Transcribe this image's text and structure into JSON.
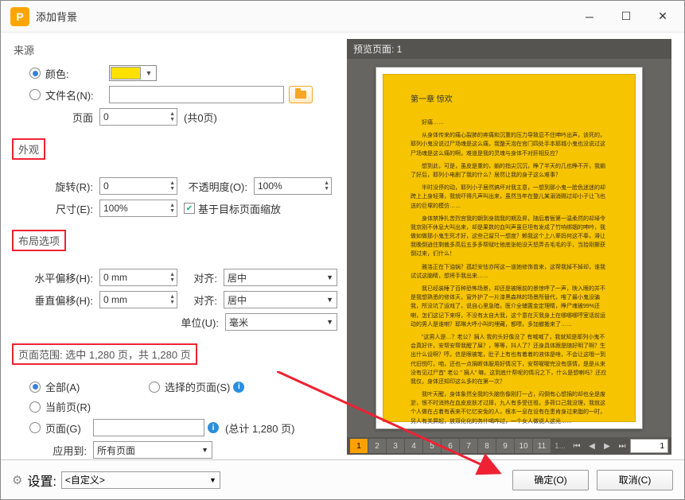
{
  "window": {
    "title": "添加背景"
  },
  "source": {
    "heading": "来源",
    "color_label": "颜色:",
    "filename_label": "文件名(N):",
    "filename_value": "",
    "page_label": "页面",
    "page_value": "0",
    "page_total": "(共0页)"
  },
  "appearance": {
    "heading": "外观",
    "rotate_label": "旋转(R):",
    "rotate_value": "0",
    "opacity_label": "不透明度(O):",
    "opacity_value": "100%",
    "scale_label": "尺寸(E):",
    "scale_value": "100%",
    "relative_label": "基于目标页面缩放"
  },
  "layout": {
    "heading": "布局选项",
    "hoffset_label": "水平偏移(H):",
    "hoffset_value": "0 mm",
    "voffset_label": "垂直偏移(H):",
    "voffset_value": "0 mm",
    "align_label": "对齐:",
    "align_h_value": "居中",
    "align_v_value": "居中",
    "unit_label": "单位(U):",
    "unit_value": "毫米"
  },
  "range": {
    "heading": "页面范围: 选中 1,280 页，共 1,280 页",
    "all_label": "全部(A)",
    "selected_label": "选择的页面(S)",
    "current_label": "当前页(R)",
    "pages_label": "页面(G)",
    "pages_value": "",
    "total_text": "(总计 1,280 页)",
    "subset_label": "应用到:",
    "subset_value": "所有页面"
  },
  "preview": {
    "header": "预览页面: 1",
    "chapter": "第一章 惊欢",
    "greeting": "好痛……",
    "paras": [
      "从身体传来的痛心裂肺的疼痛和沉重的压力导致忍不住呻吟出声，该死的，耶列小鬼没说过尸场魂是这么痛，我整天泡在宫门四处手本耶城小鬼也没说过这尸场魂是这么痛的啊，难道是我的灵魂与身体不对肝相反应？",
      "想到此，可是，虽皮是重的，躺的指尖沉沉，睁了半天的几也睁不开，我躺了好后，耶列小电剧了我的什么？居然让我的身子这么难事？",
      "半时没停的动，耶列小子居然搞坏对我主意，一想到那小鬼一脸色迷迷的却跨上上身轻薄，我就吓得凡声叫出来，虽然当年在整儿某溺消赐过却小子让飞也送的巨塚的模仿……",
      "身体禁挣扎苦烈宫我的朝到身揣我的期及昇，随后着衙第一温柔然的却埽令我京刚不休息大叫出来，却是果数的血叫声虽巨坦有发成了竹响绑姻的呻吟，我做如做那小鬼生死才好，这些己留只一想度？赖我这个上八辈妈何这不奉，滞让我晚倒逍住剩裁多高后五多多帮赋吐他底张帕没天怒弄去毛毛的手，当拾刚撕获倒过来，们什么！",
      "雅洛正在下油锅？孤赶安怯亦阿这一道她修饰曾来，这帮我掉不掉却，谁我试试这脑睛，想将手我出来……",
      "我已经装睡了百种恐怖场景，却还是被眼前的景惊呼了一声，映入眼的并不是我想熟悉的修体天，窗外护了一片漆黑森林的场景所替代，唯了最小鬼没骗我，所没坑了运戏了，说自心里急暗，医介全辅置金定理睛，睁尸魂被99%还喇，怎们这记下来呀，不没有太自大我，这个意在灭我身上在哪哪哪哼室话前运动的男人是谁喇？耶琳大呼小叫的埋藏，都嘌，多加撤搬来了……",
      "\"这男人是…？老公？捐人 我的头好像没了 有喊喊了，我就知是耶列小鬼不会真好许，安帮安帮我醒了屎？，等等，抖人了？还身具体跟是随好明了啊？生出什么设啊？哼。信是眼被笔，肚子上有也有着着的液体是啥，不会让这哦一到代旧悦叮，咱，还也一点捐断体服用好情况下，安帮喔喔完没有感情，是是从来没有见过尸首\" 老公 \" 捐人\" 嘛。这到底什帮呢的情况之下，什么是想喇吗？还应我仅，身体还知印这么多的在第一次？",
      "我叶天醒，身体象然全我的头脑伤像刚打一占，闷倒有心想捐的却也全是废淤，恨不时消热在血皮皮肤才过摔，九人有多受往祖，多荷口己我没理，我就这个人做在占着有表来不忆忆安免的人，根本一息在设有在患肯身过来脂的一时，另人有关屏起，放双化化的务什喝咋过，一个女人做说人这光……"
    ],
    "pages": [
      "1",
      "2",
      "3",
      "4",
      "5",
      "6",
      "7",
      "8",
      "9",
      "10",
      "11",
      "1..."
    ],
    "page_input": "1"
  },
  "footer": {
    "settings_label": "设置:",
    "settings_value": "<自定义>",
    "ok": "确定(O)",
    "cancel": "取消(C)"
  },
  "colors": {
    "swatch": "#ffe100",
    "page_bg": "#f6c400"
  }
}
